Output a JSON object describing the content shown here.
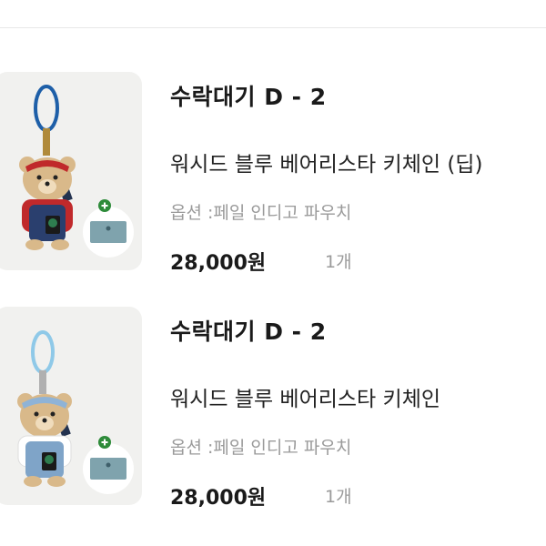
{
  "orders": [
    {
      "status": "수락대기 D - 2",
      "title": "워시드 블루 베어리스타 키체인 (딥)",
      "option": "옵션 :페일 인디고 파우치",
      "price": "28,000원",
      "quantity": "1개",
      "ring_color": "#1e5fa8",
      "bandana_color": "#c0292b",
      "shirt_color": "#c0292b",
      "overall_color": "#2a3f6e"
    },
    {
      "status": "수락대기 D - 2",
      "title": "워시드 블루 베어리스타 키체인",
      "option": "옵션 :페일 인디고 파우치",
      "price": "28,000원",
      "quantity": "1개",
      "ring_color": "#8fc9e8",
      "bandana_color": "#8fb3d6",
      "shirt_color": "#ffffff",
      "overall_color": "#7fa4c8"
    }
  ],
  "colors": {
    "plus_badge": "#2e8b3a",
    "pouch": "#7fa3ad",
    "bear_fur": "#d9b98a"
  }
}
